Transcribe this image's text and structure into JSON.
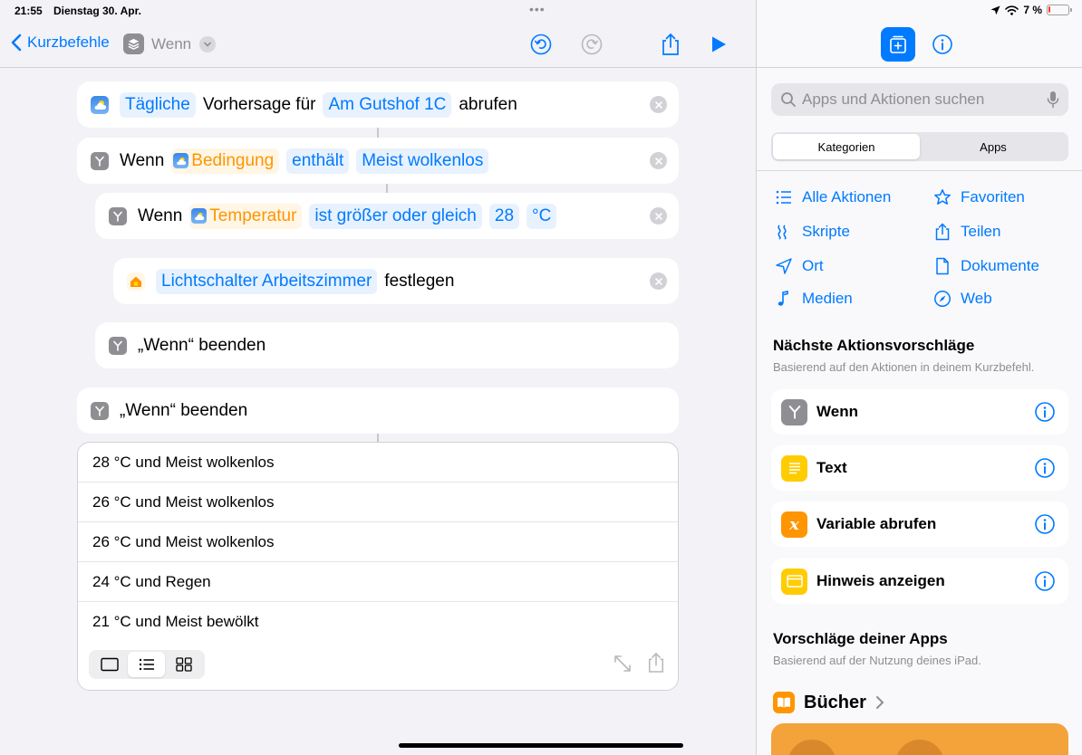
{
  "status_bar": {
    "time": "21:55",
    "date": "Dienstag 30. Apr.",
    "battery_percent": "7 %",
    "battery_level": 0.07
  },
  "toolbar": {
    "back_label": "Kurzbefehle",
    "shortcut_title": "Wenn",
    "accent_color": "#007aff"
  },
  "actions": {
    "weather": {
      "token_type": "Tägliche",
      "text_1": "Vorhersage für",
      "token_location": "Am Gutshof 1C",
      "text_2": "abrufen"
    },
    "if_outer": {
      "keyword": "Wenn",
      "variable": "Bedingung",
      "operator": "enthält",
      "value": "Meist wolkenlos"
    },
    "if_inner": {
      "keyword": "Wenn",
      "variable": "Temperatur",
      "operator": "ist größer oder gleich",
      "value": "28",
      "unit": "°C"
    },
    "home": {
      "token_device": "Lichtschalter Arbeitszimmer",
      "text": "festlegen"
    },
    "end_inner": {
      "label": "„Wenn“ beenden"
    },
    "end_outer": {
      "label": "„Wenn“ beenden"
    }
  },
  "results": [
    "28 °C und Meist wolkenlos",
    "26 °C und Meist wolkenlos",
    "26 °C und Meist wolkenlos",
    "24 °C und Regen",
    "21 °C und Meist bewölkt"
  ],
  "sidebar": {
    "search_placeholder": "Apps und Aktionen suchen",
    "tabs": [
      "Kategorien",
      "Apps"
    ],
    "active_tab": "Kategorien",
    "categories": [
      {
        "label": "Alle Aktionen",
        "icon": "list-icon"
      },
      {
        "label": "Favoriten",
        "icon": "star-icon"
      },
      {
        "label": "Skripte",
        "icon": "script-icon"
      },
      {
        "label": "Teilen",
        "icon": "share-icon"
      },
      {
        "label": "Ort",
        "icon": "location-icon"
      },
      {
        "label": "Dokumente",
        "icon": "document-icon"
      },
      {
        "label": "Medien",
        "icon": "music-note-icon"
      },
      {
        "label": "Web",
        "icon": "compass-icon"
      }
    ],
    "suggestions_title": "Nächste Aktionsvorschläge",
    "suggestions_subtitle": "Basierend auf den Aktionen in deinem Kurzbefehl.",
    "suggestions": [
      {
        "label": "Wenn",
        "icon": "branch-icon",
        "color": "#8e8e93"
      },
      {
        "label": "Text",
        "icon": "text-icon",
        "color": "#ffcc00"
      },
      {
        "label": "Variable abrufen",
        "icon": "variable-icon",
        "color": "#ff9500"
      },
      {
        "label": "Hinweis anzeigen",
        "icon": "alert-icon",
        "color": "#ffcc00"
      }
    ],
    "apps_title": "Vorschläge deiner Apps",
    "apps_subtitle": "Basierend auf der Nutzung deines iPad.",
    "app_name": "Bücher"
  }
}
